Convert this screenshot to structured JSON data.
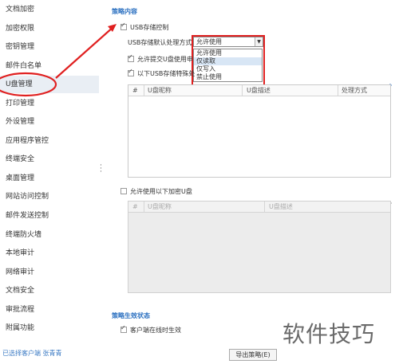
{
  "sidebar": {
    "items": [
      {
        "label": "文档加密"
      },
      {
        "label": "加密权限"
      },
      {
        "label": "密钥管理"
      },
      {
        "label": "邮件白名单"
      },
      {
        "label": "U盘管理",
        "active": true
      },
      {
        "label": "打印管理"
      },
      {
        "label": "外设管理"
      },
      {
        "label": "应用程序管控"
      },
      {
        "label": "终端安全"
      },
      {
        "label": "桌面管理"
      },
      {
        "label": "网站访问控制"
      },
      {
        "label": "邮件发送控制"
      },
      {
        "label": "终端防火墙"
      },
      {
        "label": "本地审计"
      },
      {
        "label": "网络审计"
      },
      {
        "label": "文档安全"
      },
      {
        "label": "审批流程"
      },
      {
        "label": "附属功能"
      }
    ]
  },
  "status_bar": {
    "text": "已选择客户端 张青青"
  },
  "main": {
    "section_policy_title": "策略内容",
    "usb_control": {
      "label": "USB存储控制",
      "checked": true
    },
    "default_handling": {
      "label": "USB存储默认处理方式",
      "selected": "允许使用",
      "options": [
        "允许使用",
        "仅读取",
        "仅写入",
        "禁止使用"
      ],
      "hovered": "仅读取"
    },
    "allow_submit": {
      "label": "允许提交U盘使用申",
      "checked": true
    },
    "special_usb": {
      "label": "以下USB存储特殊处",
      "checked": true
    },
    "table1": {
      "columns": [
        "#",
        "U盘昵称",
        "U盘描述",
        "处理方式"
      ]
    },
    "encrypted_usb": {
      "label": "允许使用以下加密U盘",
      "checked": false
    },
    "table2": {
      "columns": [
        "#",
        "U盘昵称",
        "U盘描述"
      ]
    },
    "section_effect_title": "策略生效状态",
    "offline_effect": {
      "label": "客户端在线时生效",
      "checked": true
    },
    "export_button": "导出策略(E)"
  },
  "colors": {
    "accent": "#2a6fc0",
    "highlight_red": "#e02020",
    "active_bg": "#e9eef4"
  },
  "icons": [
    "pencil-edit-icon",
    "checkbox-icon",
    "dropdown-arrow-icon"
  ],
  "watermark": "软件技巧"
}
